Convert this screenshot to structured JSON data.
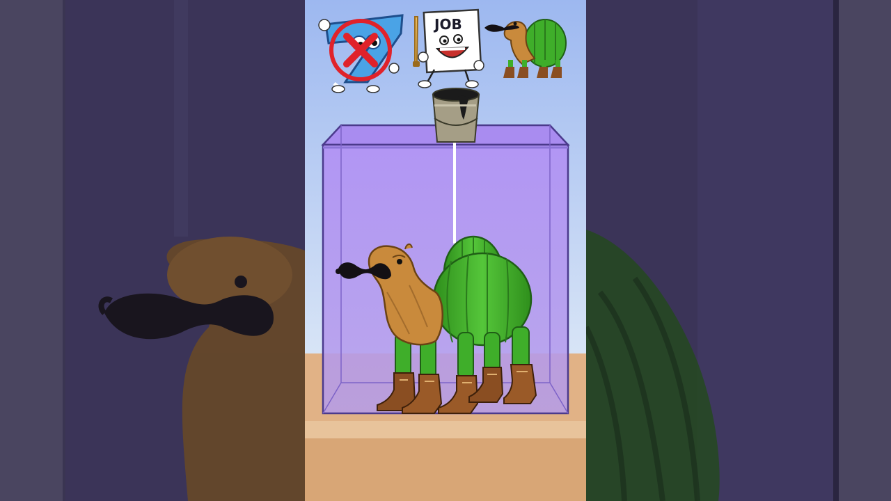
{
  "game": {
    "job_card_label": "JOB"
  },
  "colors": {
    "sky_top": "#9db8f0",
    "sky_bottom": "#d7e4f6",
    "glass_tint": "#b495f0",
    "glass_border": "#4b3a8c",
    "floor": "#d9a878",
    "cactus_green": "#3fae2a",
    "camel_tan": "#c98a3c",
    "boot_brown": "#8a4e22",
    "no_symbol_red": "#e0222a"
  },
  "icons": {
    "option_1": "number-seven-with-prohibit-icon",
    "option_2": "job-paper-character-icon",
    "option_3": "cactus-camel-icon",
    "dropper": "paint-bucket-icon"
  }
}
